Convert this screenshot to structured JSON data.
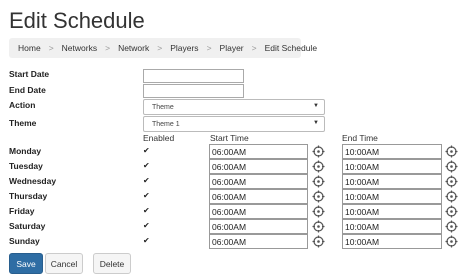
{
  "page": {
    "title": "Edit Schedule"
  },
  "breadcrumb": [
    "Home",
    "Networks",
    "Network",
    "Players",
    "Player",
    "Edit Schedule"
  ],
  "form": {
    "start_date": {
      "label": "Start Date",
      "value": ""
    },
    "end_date": {
      "label": "End Date",
      "value": ""
    },
    "action": {
      "label": "Action",
      "selected": "Theme"
    },
    "theme": {
      "label": "Theme",
      "selected": "Theme 1"
    }
  },
  "columns": {
    "enabled": "Enabled",
    "start_time": "Start Time",
    "end_time": "End Time"
  },
  "days": [
    {
      "name": "Monday",
      "enabled": true,
      "start": "06:00AM",
      "end": "10:00AM"
    },
    {
      "name": "Tuesday",
      "enabled": true,
      "start": "06:00AM",
      "end": "10:00AM"
    },
    {
      "name": "Wednesday",
      "enabled": true,
      "start": "06:00AM",
      "end": "10:00AM"
    },
    {
      "name": "Thursday",
      "enabled": true,
      "start": "06:00AM",
      "end": "10:00AM"
    },
    {
      "name": "Friday",
      "enabled": true,
      "start": "06:00AM",
      "end": "10:00AM"
    },
    {
      "name": "Saturday",
      "enabled": true,
      "start": "06:00AM",
      "end": "10:00AM"
    },
    {
      "name": "Sunday",
      "enabled": true,
      "start": "06:00AM",
      "end": "10:00AM"
    }
  ],
  "icons": {
    "time_picker": "crosshair-clock-icon",
    "checkbox": "checkmark-icon",
    "dropdown": "caret-down-icon"
  },
  "buttons": {
    "save": "Save",
    "cancel": "Cancel",
    "delete": "Delete"
  },
  "colors": {
    "primary": "#2e6da4",
    "breadcrumb_bg": "#f0f0f0"
  }
}
